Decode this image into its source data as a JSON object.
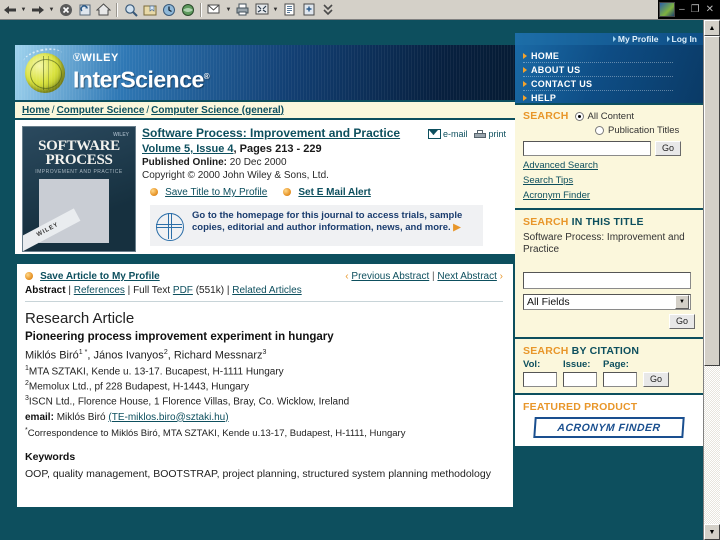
{
  "browser": {
    "toolbar_icons": [
      "back-icon",
      "back-dropdown-icon",
      "forward-icon",
      "forward-dropdown-icon",
      "stop-icon",
      "refresh-icon",
      "home-icon",
      "search-icon",
      "favorites-icon",
      "history-icon",
      "channels-icon",
      "mail-icon",
      "mail-dropdown-icon",
      "print-icon",
      "fullscreen-icon",
      "fullscreen-dropdown-icon",
      "edit-icon",
      "messenger-icon",
      "discuss-icon"
    ],
    "window_buttons": {
      "minimize": "–",
      "restore": "❐",
      "close": "✕"
    }
  },
  "topbar": {
    "my_profile": "My Profile",
    "log_in": "Log In"
  },
  "nav": {
    "items": [
      "HOME",
      "ABOUT US",
      "CONTACT US",
      "HELP"
    ]
  },
  "masthead": {
    "wiley": "WILEY",
    "interscience": "InterScience",
    "registered_mark": "®"
  },
  "breadcrumb": {
    "items": [
      "Home",
      "Computer Science",
      "Computer Science (general)"
    ],
    "separator": "/"
  },
  "journal": {
    "cover": {
      "title_line1": "SOFTWARE",
      "title_line2": "PROCESS",
      "subtitle": "IMPROVEMENT AND PRACTICE",
      "band_text": "WILEY",
      "corner_logo": "WILEY"
    },
    "title": "Software Process: Improvement and Practice",
    "volume_issue": "Volume 5, Issue 4",
    "pages": ", Pages 213 - 229",
    "published_label": "Published Online:",
    "published_date": "20 Dec 2000",
    "copyright": "Copyright © 2000 John Wiley & Sons, Ltd.",
    "save_title": "Save Title to My Profile",
    "email_alert": "Set E Mail Alert",
    "homepage_note": "Go to the homepage for this journal to access trials, sample copies, editorial and author information, news, and more.",
    "homepage_arrow": "▶",
    "email_label": "e-mail",
    "print_label": "print"
  },
  "article_nav": {
    "save_article": "Save Article to My Profile",
    "previous": "Previous Abstract",
    "next": "Next Abstract",
    "prev_chevron": "‹",
    "next_chevron": "›",
    "separator": "|",
    "tabs": {
      "abstract": "Abstract",
      "references": "References",
      "fulltext_label": "Full Text",
      "pdf": "PDF",
      "pdf_size": "(551k)",
      "related": "Related Articles"
    }
  },
  "article": {
    "type": "Research Article",
    "title": "Pioneering process improvement experiment in hungary",
    "authors": [
      {
        "name": "Miklós Biró",
        "marks": "1 *"
      },
      {
        "name": "János Ivanyos",
        "marks": "2"
      },
      {
        "name": "Richard Messnarz",
        "marks": "3"
      }
    ],
    "affiliations": [
      {
        "num": "1",
        "text": "MTA SZTAKI, Kende u. 13-17. Bucapest, H-1111 Hungary"
      },
      {
        "num": "2",
        "text": "Memolux Ltd., pf 228 Budapest, H-1443, Hungary"
      },
      {
        "num": "3",
        "text": "ISCN Ltd., Florence House, 1 Florence Villas, Bray, Co. Wicklow, Ireland"
      }
    ],
    "email_label": "email:",
    "email_name": "Miklós Biró",
    "email_address": "(TE-miklos.biro@sztaki.hu)",
    "correspondence_mark": "*",
    "correspondence": "Correspondence to Miklós Biró, MTA SZTAKI, Kende u.13-17, Budapest, H-1111, Hungary",
    "keywords_heading": "Keywords",
    "keywords": "OOP, quality management, BOOTSTRAP, project planning, structured system planning methodology"
  },
  "search": {
    "heading_orange": "SEARCH",
    "heading_rest": "",
    "options": [
      {
        "label": "All Content",
        "selected": true
      },
      {
        "label": "Publication Titles",
        "selected": false
      }
    ],
    "query": "",
    "go": "Go",
    "links": [
      "Advanced Search",
      "Search Tips",
      "Acronym Finder"
    ]
  },
  "search_title": {
    "heading_orange": "SEARCH",
    "heading_rest": "IN THIS TITLE",
    "journal_name": "Software Process: Improvement and Practice",
    "query": "",
    "field_selected": "All Fields",
    "dropdown_arrow": "▼",
    "go": "Go"
  },
  "search_citation": {
    "heading_orange": "SEARCH",
    "heading_rest": "BY CITATION",
    "fields": [
      {
        "label": "Vol:",
        "value": ""
      },
      {
        "label": "Issue:",
        "value": ""
      },
      {
        "label": "Page:",
        "value": ""
      }
    ],
    "go": "Go"
  },
  "featured": {
    "heading": "FEATURED PRODUCT",
    "badge": "ACRONYM FINDER"
  },
  "scrollbar": {
    "up_arrow": "▲",
    "down_arrow": "▼"
  },
  "colors": {
    "navy": "#0d4f5e",
    "orange": "#e8962a",
    "cream": "#fbf7dc",
    "blue": "#0e4d85"
  }
}
